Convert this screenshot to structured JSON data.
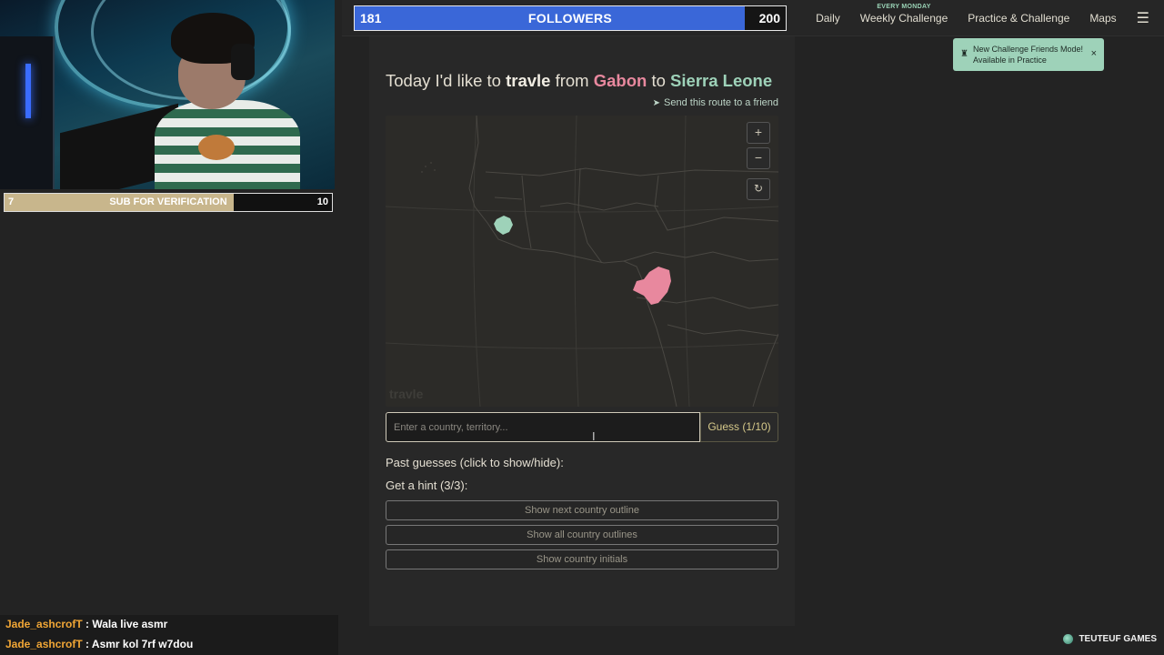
{
  "stream": {
    "sub_goal": {
      "current": "7",
      "label": "SUB FOR VERIFICATION",
      "target": "10",
      "progress": 0.7
    },
    "follower_goal": {
      "current": "181",
      "label": "FOLLOWERS",
      "target": "200",
      "progress": 0.905
    },
    "chat": [
      {
        "user": "Jade_ashcrofT",
        "message": "Wala live asmr"
      },
      {
        "user": "Jade_ashcrofT",
        "message": "Asmr kol 7rf w7dou"
      }
    ],
    "brand": "TEUTEUF GAMES"
  },
  "nav": {
    "daily": "Daily",
    "weekly_tag": "EVERY MONDAY",
    "weekly": "Weekly Challenge",
    "practice": "Practice & Challenge",
    "maps": "Maps",
    "menu_icon": "hamburger-icon"
  },
  "toast": {
    "text": "New Challenge Friends Mode! Available in Practice",
    "close": "×"
  },
  "game": {
    "headline": {
      "prefix": "Today I'd like to",
      "travle": "travle",
      "from_word": "from",
      "from_country": "Gabon",
      "to_word": "to",
      "to_country": "Sierra Leone"
    },
    "send_route": "Send this route to a friend",
    "map_controls": {
      "zoom_in": "+",
      "zoom_out": "−",
      "reset": "↻"
    },
    "map_watermark": "travle",
    "colors": {
      "from": "#e8889e",
      "to": "#9ed2b9",
      "accent": "#d6c98a"
    },
    "input_placeholder": "Enter a country, territory...",
    "guess_button": "Guess (1/10)",
    "past_guesses": "Past guesses (click to show/hide):",
    "hint_header": "Get a hint (3/3):",
    "hints": [
      "Show next country outline",
      "Show all country outlines",
      "Show country initials"
    ]
  }
}
